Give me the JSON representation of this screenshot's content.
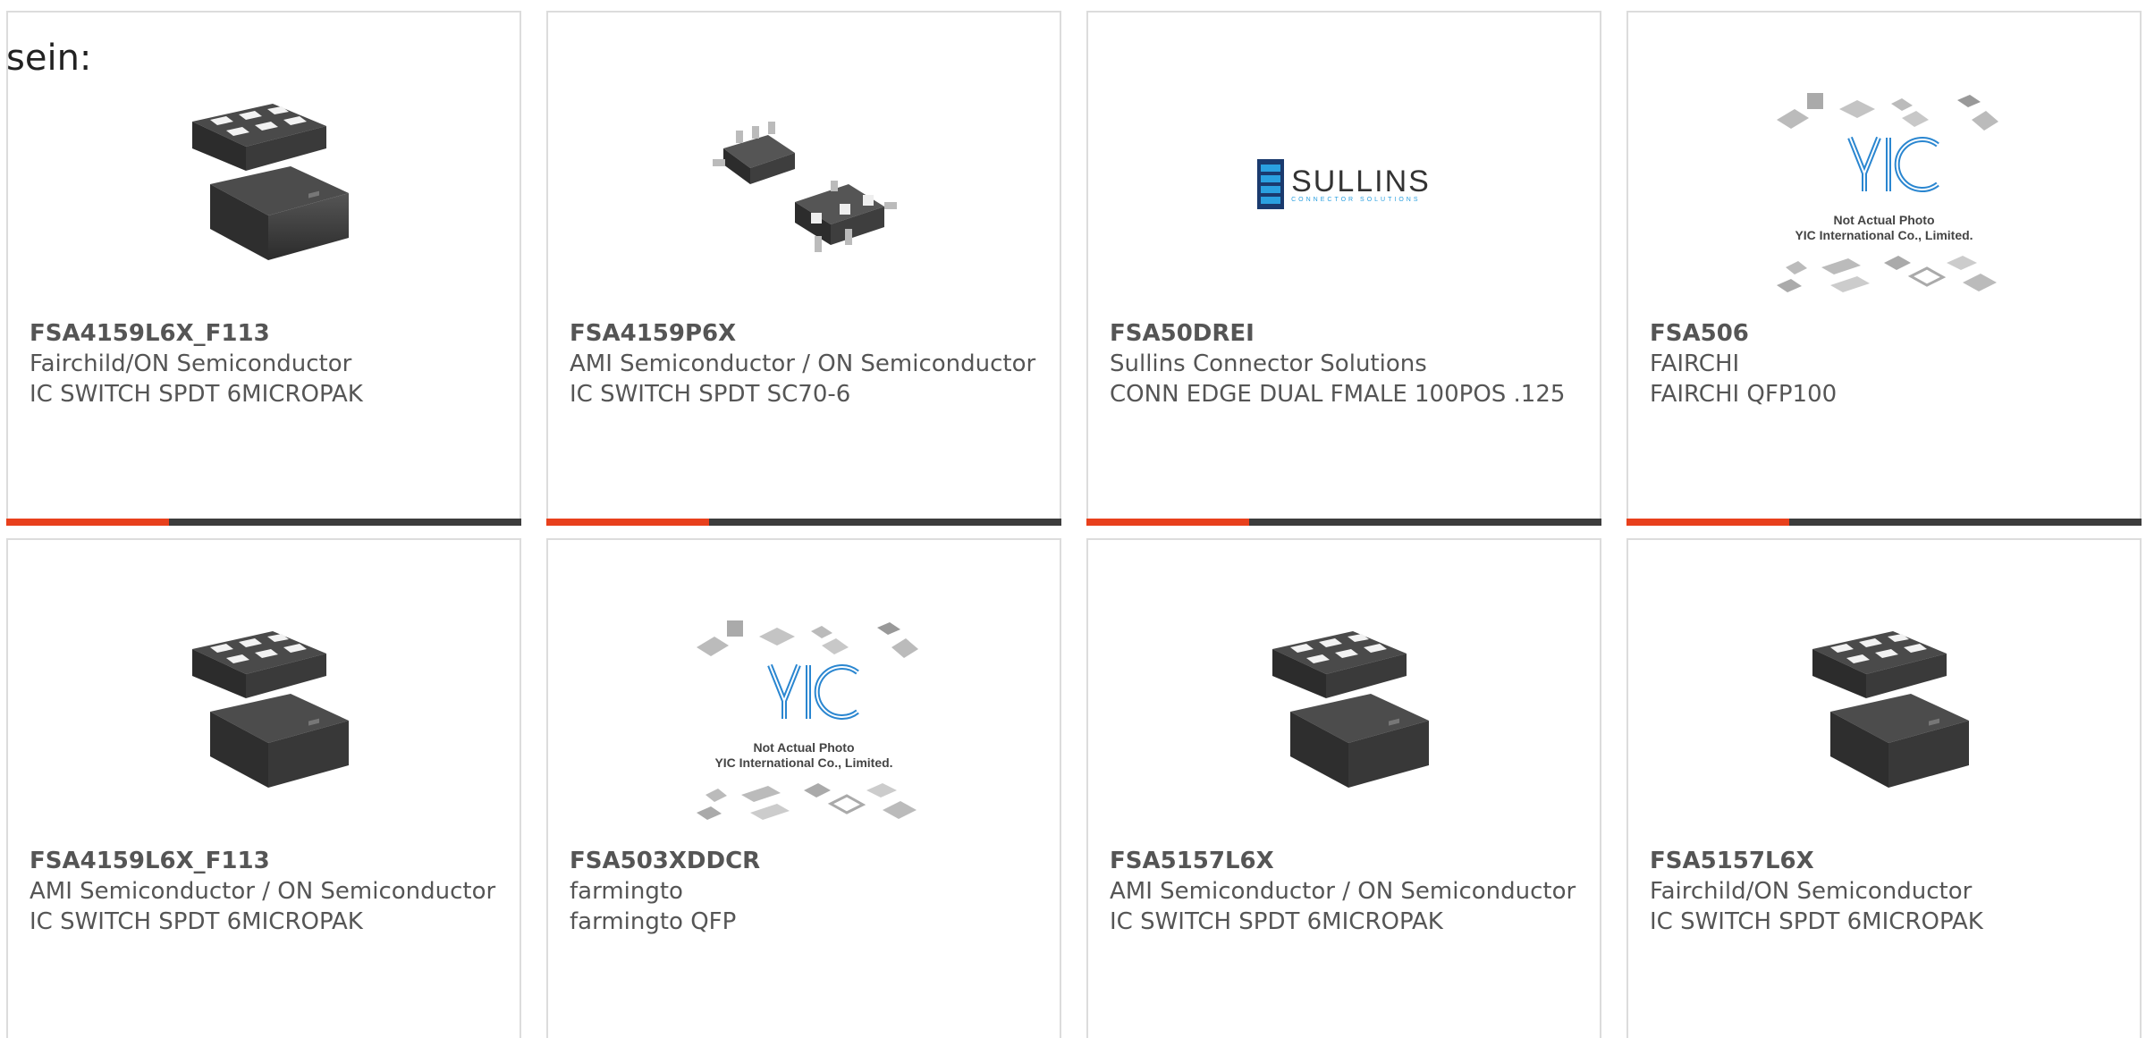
{
  "intro_text": "sein:",
  "colors": {
    "accent": "#e8401c",
    "bar": "#3c3c3c",
    "border": "#dcdcdc"
  },
  "products": [
    {
      "part_number": "FSA4159L6X_F113",
      "manufacturer": "Fairchild/ON Semiconductor",
      "description": "IC SWITCH SPDT 6MICROPAK",
      "image": "micropak-chip"
    },
    {
      "part_number": "FSA4159P6X",
      "manufacturer": "AMI Semiconductor / ON Semiconductor",
      "description": "IC SWITCH SPDT SC70-6",
      "image": "sc70-chip"
    },
    {
      "part_number": "FSA50DREI",
      "manufacturer": "Sullins Connector Solutions",
      "description": "CONN EDGE DUAL FMALE 100POS .125",
      "image": "sullins-logo",
      "logo_text": "SULLINS",
      "logo_sub": "CONNECTOR SOLUTIONS"
    },
    {
      "part_number": "FSA506",
      "manufacturer": "FAIRCHI",
      "description": "FAIRCHI QFP100",
      "image": "yic-placeholder",
      "placeholder_line1": "Not Actual Photo",
      "placeholder_line2": "YIC International Co., Limited."
    },
    {
      "part_number": "FSA4159L6X_F113",
      "manufacturer": "AMI Semiconductor / ON Semiconductor",
      "description": "IC SWITCH SPDT 6MICROPAK",
      "image": "micropak-chip"
    },
    {
      "part_number": "FSA503XDDCR",
      "manufacturer": "farmingto",
      "description": "farmingto QFP",
      "image": "yic-placeholder",
      "placeholder_line1": "Not Actual Photo",
      "placeholder_line2": "YIC International Co., Limited."
    },
    {
      "part_number": "FSA5157L6X",
      "manufacturer": "AMI Semiconductor / ON Semiconductor",
      "description": "IC SWITCH SPDT 6MICROPAK",
      "image": "micropak-chip"
    },
    {
      "part_number": "FSA5157L6X",
      "manufacturer": "Fairchild/ON Semiconductor",
      "description": "IC SWITCH SPDT 6MICROPAK",
      "image": "micropak-chip"
    }
  ]
}
